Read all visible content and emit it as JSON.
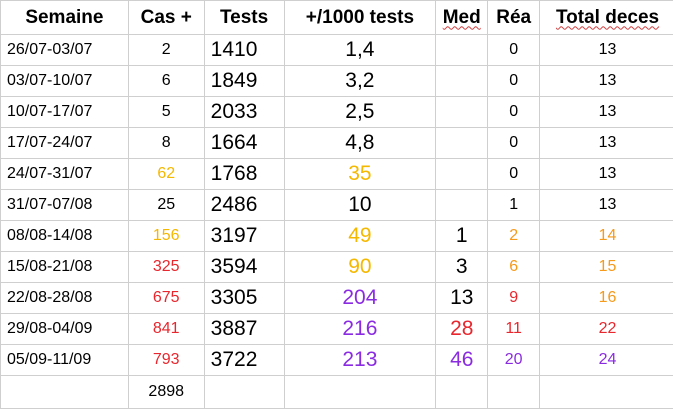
{
  "colors": {
    "black": "#000000",
    "yellow": "#f5b800",
    "orange": "#f59a1a",
    "red": "#e8262d",
    "purple": "#8a2be2",
    "grid": "#cfcfcf"
  },
  "headers": {
    "week": "Semaine",
    "cases": "Cas +",
    "tests": "Tests",
    "ratio": "+/1000 tests",
    "med": "Med",
    "rea": "Réa",
    "deaths": "Total deces"
  },
  "rows": [
    {
      "week": "26/07-03/07",
      "cases": "2",
      "cases_color": "black",
      "tests": "1410",
      "ratio": "1,4",
      "ratio_color": "black",
      "med": "",
      "med_color": "black",
      "rea": "0",
      "rea_color": "black",
      "deaths": "13",
      "deaths_color": "black"
    },
    {
      "week": "03/07-10/07",
      "cases": "6",
      "cases_color": "black",
      "tests": "1849",
      "ratio": "3,2",
      "ratio_color": "black",
      "med": "",
      "med_color": "black",
      "rea": "0",
      "rea_color": "black",
      "deaths": "13",
      "deaths_color": "black"
    },
    {
      "week": "10/07-17/07",
      "cases": "5",
      "cases_color": "black",
      "tests": "2033",
      "ratio": "2,5",
      "ratio_color": "black",
      "med": "",
      "med_color": "black",
      "rea": "0",
      "rea_color": "black",
      "deaths": "13",
      "deaths_color": "black"
    },
    {
      "week": "17/07-24/07",
      "cases": "8",
      "cases_color": "black",
      "tests": "1664",
      "ratio": "4,8",
      "ratio_color": "black",
      "med": "",
      "med_color": "black",
      "rea": "0",
      "rea_color": "black",
      "deaths": "13",
      "deaths_color": "black"
    },
    {
      "week": "24/07-31/07",
      "cases": "62",
      "cases_color": "yellow",
      "tests": "1768",
      "ratio": "35",
      "ratio_color": "yellow",
      "med": "",
      "med_color": "black",
      "rea": "0",
      "rea_color": "black",
      "deaths": "13",
      "deaths_color": "black"
    },
    {
      "week": "31/07-07/08",
      "cases": "25",
      "cases_color": "black",
      "tests": "2486",
      "ratio": "10",
      "ratio_color": "black",
      "med": "",
      "med_color": "black",
      "rea": "1",
      "rea_color": "black",
      "deaths": "13",
      "deaths_color": "black"
    },
    {
      "week": "08/08-14/08",
      "cases": "156",
      "cases_color": "yellow",
      "tests": "3197",
      "ratio": "49",
      "ratio_color": "yellow",
      "med": "1",
      "med_color": "black",
      "rea": "2",
      "rea_color": "orange",
      "deaths": "14",
      "deaths_color": "orange"
    },
    {
      "week": "15/08-21/08",
      "cases": "325",
      "cases_color": "red",
      "tests": "3594",
      "ratio": "90",
      "ratio_color": "yellow",
      "med": "3",
      "med_color": "black",
      "rea": "6",
      "rea_color": "orange",
      "deaths": "15",
      "deaths_color": "orange"
    },
    {
      "week": "22/08-28/08",
      "cases": "675",
      "cases_color": "red",
      "tests": "3305",
      "ratio": "204",
      "ratio_color": "purple",
      "med": "13",
      "med_color": "black",
      "rea": "9",
      "rea_color": "red",
      "deaths": "16",
      "deaths_color": "orange"
    },
    {
      "week": "29/08-04/09",
      "cases": "841",
      "cases_color": "red",
      "tests": "3887",
      "ratio": "216",
      "ratio_color": "purple",
      "med": "28",
      "med_color": "red",
      "rea": "11",
      "rea_color": "red",
      "deaths": "22",
      "deaths_color": "red"
    },
    {
      "week": "05/09-11/09",
      "cases": "793",
      "cases_color": "red",
      "tests": "3722",
      "ratio": "213",
      "ratio_color": "purple",
      "med": "46",
      "med_color": "purple",
      "rea": "20",
      "rea_color": "purple",
      "deaths": "24",
      "deaths_color": "purple"
    }
  ],
  "total": {
    "cases": "2898"
  }
}
